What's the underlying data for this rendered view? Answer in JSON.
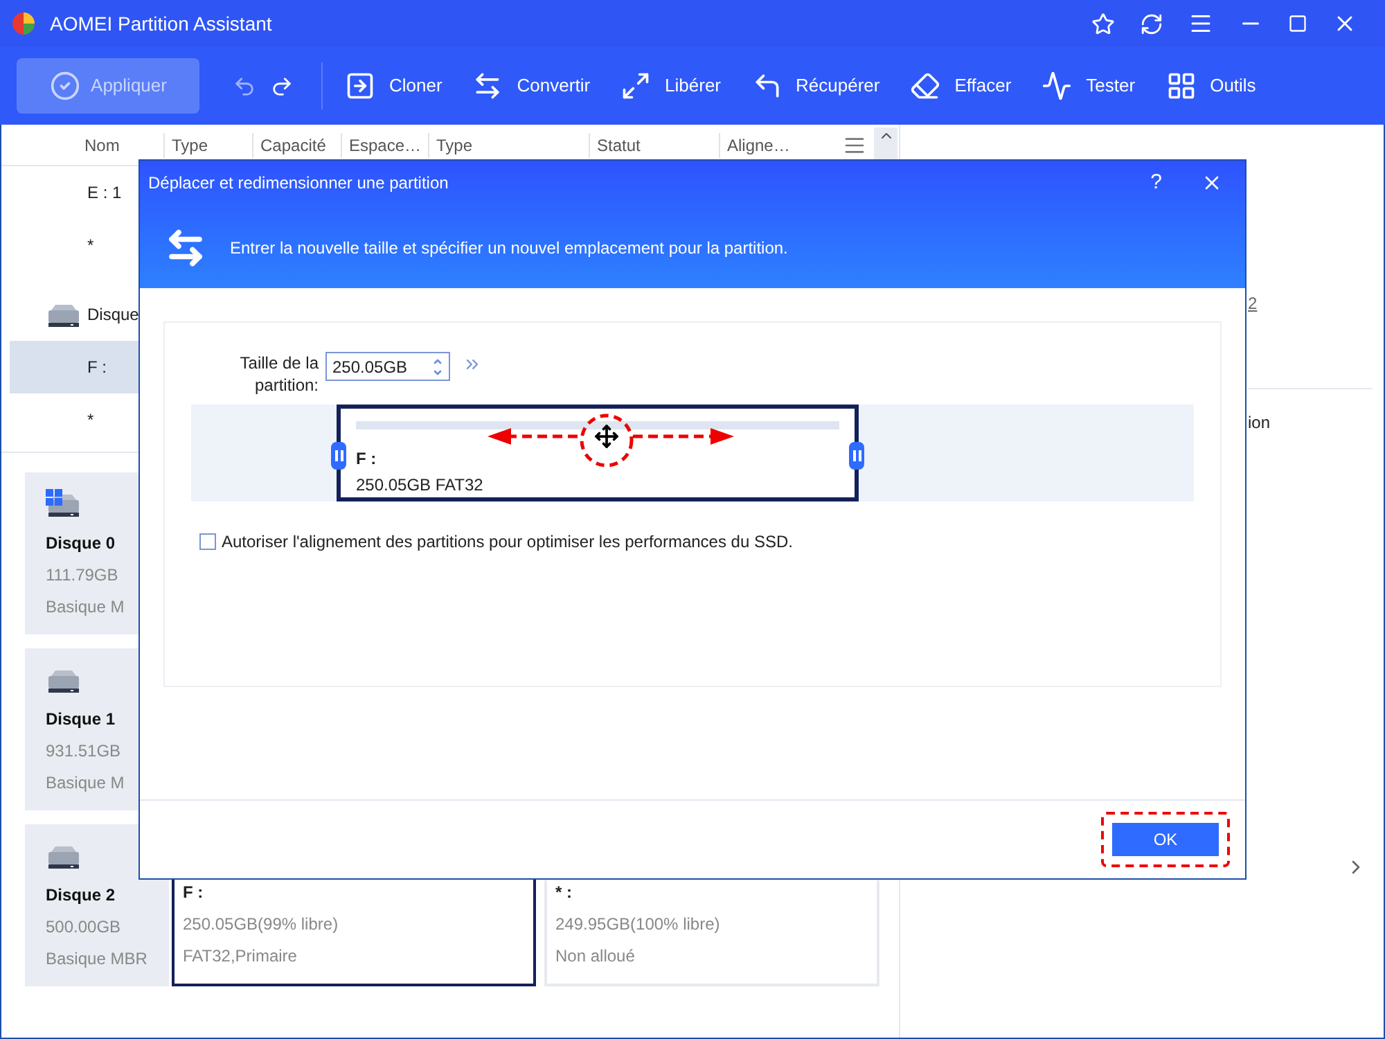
{
  "window": {
    "title": "AOMEI Partition Assistant"
  },
  "toolbar": {
    "apply": {
      "label": "Appliquer",
      "disabled": true
    },
    "tools": [
      {
        "label": "Cloner"
      },
      {
        "label": "Convertir"
      },
      {
        "label": "Libérer"
      },
      {
        "label": "Récupérer"
      },
      {
        "label": "Effacer"
      },
      {
        "label": "Tester"
      },
      {
        "label": "Outils"
      }
    ]
  },
  "table": {
    "columns": [
      "Nom",
      "Type",
      "Capacité",
      "Espace…",
      "Type",
      "Statut",
      "Aligne…"
    ],
    "rows": [
      {
        "kind": "partition",
        "name": "E : 1",
        "selected": false
      },
      {
        "kind": "partition",
        "name": "*",
        "selected": false
      },
      {
        "kind": "disk",
        "name": "Disque",
        "selected": false
      },
      {
        "kind": "partition",
        "name": "F :",
        "selected": true
      },
      {
        "kind": "partition",
        "name": "*",
        "selected": false
      }
    ]
  },
  "disks": [
    {
      "kind": "system",
      "name": "Disque 0",
      "size": "111.79GB",
      "type": "Basique M"
    },
    {
      "kind": "data",
      "name": "Disque 1",
      "size": "931.51GB",
      "type": "Basique M"
    },
    {
      "kind": "data",
      "name": "Disque 2",
      "size": "500.00GB",
      "type": "Basique MBR",
      "partitions": [
        {
          "name": "F :",
          "size": "250.05GB(99% libre)",
          "info": "FAT32,Primaire",
          "selected": true
        },
        {
          "name": "* :",
          "size": "249.95GB(100% libre)",
          "info": "Non alloué",
          "selected": false
        }
      ]
    }
  ],
  "right_panel": {
    "link": "2",
    "item": "ion"
  },
  "dialog": {
    "title": "Déplacer et redimensionner une partition",
    "subtitle": "Entrer la nouvelle taille et spécifier un nouvel emplacement pour la partition.",
    "size_label": "Taille de la partition:",
    "size_value": "250.05GB",
    "partition": {
      "name": "F :",
      "info": "250.05GB FAT32"
    },
    "align_option": {
      "label": "Autoriser l'alignement des partitions pour optimiser les performances du SSD.",
      "checked": false
    },
    "help": "?",
    "ok": "OK"
  }
}
